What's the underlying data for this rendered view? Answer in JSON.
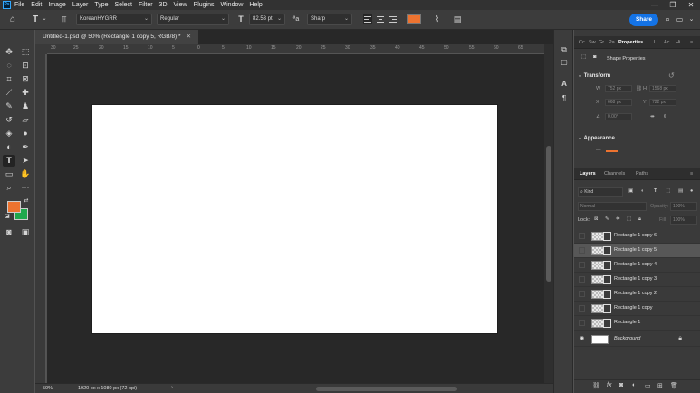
{
  "app": {
    "logo": "Ps",
    "menus": [
      "File",
      "Edit",
      "Image",
      "Layer",
      "Type",
      "Select",
      "Filter",
      "3D",
      "View",
      "Plugins",
      "Window",
      "Help"
    ],
    "window_controls": [
      "—",
      "❐",
      "✕"
    ]
  },
  "options": {
    "tool_icon": "T",
    "font_family": "KoreanHYGRR",
    "font_style": "Regular",
    "font_size": "82.53 pt",
    "antialias_label": "ªa",
    "antialias": "Sharp",
    "text_color": "#ed7330",
    "share_label": "Share"
  },
  "document": {
    "tab_title": "Untitled-1.psd @ 50% (Rectangle 1 copy 5, RGB/8) *",
    "ruler_ticks": [
      "30",
      "25",
      "20",
      "15",
      "10",
      "5",
      "0",
      "5",
      "10",
      "15",
      "20",
      "25",
      "30",
      "35",
      "40",
      "45",
      "50",
      "55",
      "60",
      "65"
    ],
    "zoom": "50%",
    "doc_info": "1920 px x 1080 px (72 ppi)"
  },
  "colors": {
    "foreground": "#ed7330",
    "background": "#1fa84d"
  },
  "panels": {
    "top_tabs": [
      "Cc",
      "Sw",
      "Gr",
      "Pa",
      "Properties",
      "Li",
      "Ac",
      "Hi"
    ],
    "properties": {
      "title": "Shape Properties",
      "transform_label": "Transform",
      "w": "752 px",
      "h": "1568 px",
      "x": "668 px",
      "y": "722 px",
      "angle": "0.00°",
      "appearance_label": "Appearance"
    },
    "layer_tabs": [
      "Layers",
      "Channels",
      "Paths"
    ],
    "filter_kind": "Kind",
    "blend_mode": "Normal",
    "opacity_label": "Opacity:",
    "opacity": "100%",
    "lock_label": "Lock:",
    "fill_label": "Fill:",
    "fill": "100%"
  },
  "layers": [
    {
      "name": "Rectangle 1 copy 6",
      "selected": false
    },
    {
      "name": "Rectangle 1 copy 5",
      "selected": true
    },
    {
      "name": "Rectangle 1 copy 4",
      "selected": false
    },
    {
      "name": "Rectangle 1 copy 3",
      "selected": false
    },
    {
      "name": "Rectangle 1 copy 2",
      "selected": false
    },
    {
      "name": "Rectangle 1 copy",
      "selected": false
    },
    {
      "name": "Rectangle 1",
      "selected": false
    },
    {
      "name": "Background",
      "selected": false
    }
  ]
}
